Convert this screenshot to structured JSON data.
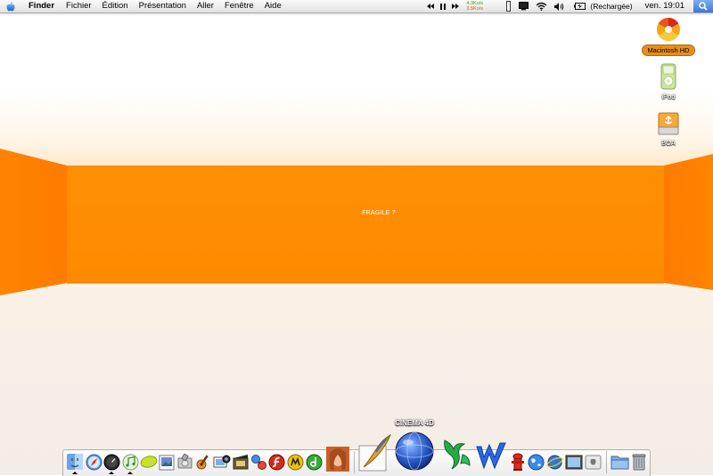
{
  "menubar": {
    "app_name": "Finder",
    "items": [
      "Fichier",
      "Édition",
      "Présentation",
      "Aller",
      "Fenêtre",
      "Aide"
    ],
    "net_upload": "4.3Ko/s",
    "net_download": "3.5Ko/s",
    "battery_status": "(Rechargée)",
    "clock": "ven. 19:01"
  },
  "desktop": {
    "icons": [
      {
        "label": "Macintosh HD",
        "icon": "hard-drive-icon",
        "selected": true
      },
      {
        "label": "iPod",
        "icon": "ipod-icon",
        "selected": false
      },
      {
        "label": "BOA",
        "icon": "external-drive-icon",
        "selected": false
      }
    ],
    "center_text": "FRAGILE ?"
  },
  "dock": {
    "hover_label": "CINEMA 4D",
    "items": [
      {
        "icon": "finder-icon",
        "running": true
      },
      {
        "icon": "safari-icon",
        "running": false
      },
      {
        "icon": "dashboard-icon",
        "running": true
      },
      {
        "icon": "itunes-icon",
        "running": true
      },
      {
        "icon": "lemon-app-icon",
        "running": false
      },
      {
        "icon": "preview-icon",
        "running": false
      },
      {
        "icon": "disk-utility-icon",
        "running": false
      },
      {
        "icon": "garageband-icon",
        "running": false
      },
      {
        "icon": "iphoto-icon",
        "running": false
      },
      {
        "icon": "imovie-icon",
        "running": false
      },
      {
        "icon": "network-app-icon",
        "running": false
      },
      {
        "icon": "flash-icon",
        "running": false
      },
      {
        "icon": "fireworks-icon",
        "running": false
      },
      {
        "icon": "dreamweaver-icon",
        "running": false
      },
      {
        "icon": "portrait-app-icon",
        "running": false
      },
      {
        "icon": "painter-brush-icon",
        "running": false
      },
      {
        "icon": "cinema-4d-icon",
        "running": false
      },
      {
        "icon": "sketchbook-icon",
        "running": false
      },
      {
        "icon": "word-icon",
        "running": false
      },
      {
        "icon": "fire-hydrant-icon",
        "running": false
      },
      {
        "icon": "globe-icon",
        "running": false
      },
      {
        "icon": "internet-explorer-icon",
        "running": false
      },
      {
        "icon": "photo-booth-icon",
        "running": false
      },
      {
        "icon": "about-mac-icon",
        "running": false
      },
      {
        "icon": "documents-folder-icon",
        "running": false
      },
      {
        "icon": "trash-icon",
        "running": false
      }
    ]
  },
  "colors": {
    "wall_orange": "#ff8a00",
    "wall_orange_dark": "#f57800",
    "selection_orange": "#e98e1b",
    "spotlight_blue": "#3c78d8"
  }
}
